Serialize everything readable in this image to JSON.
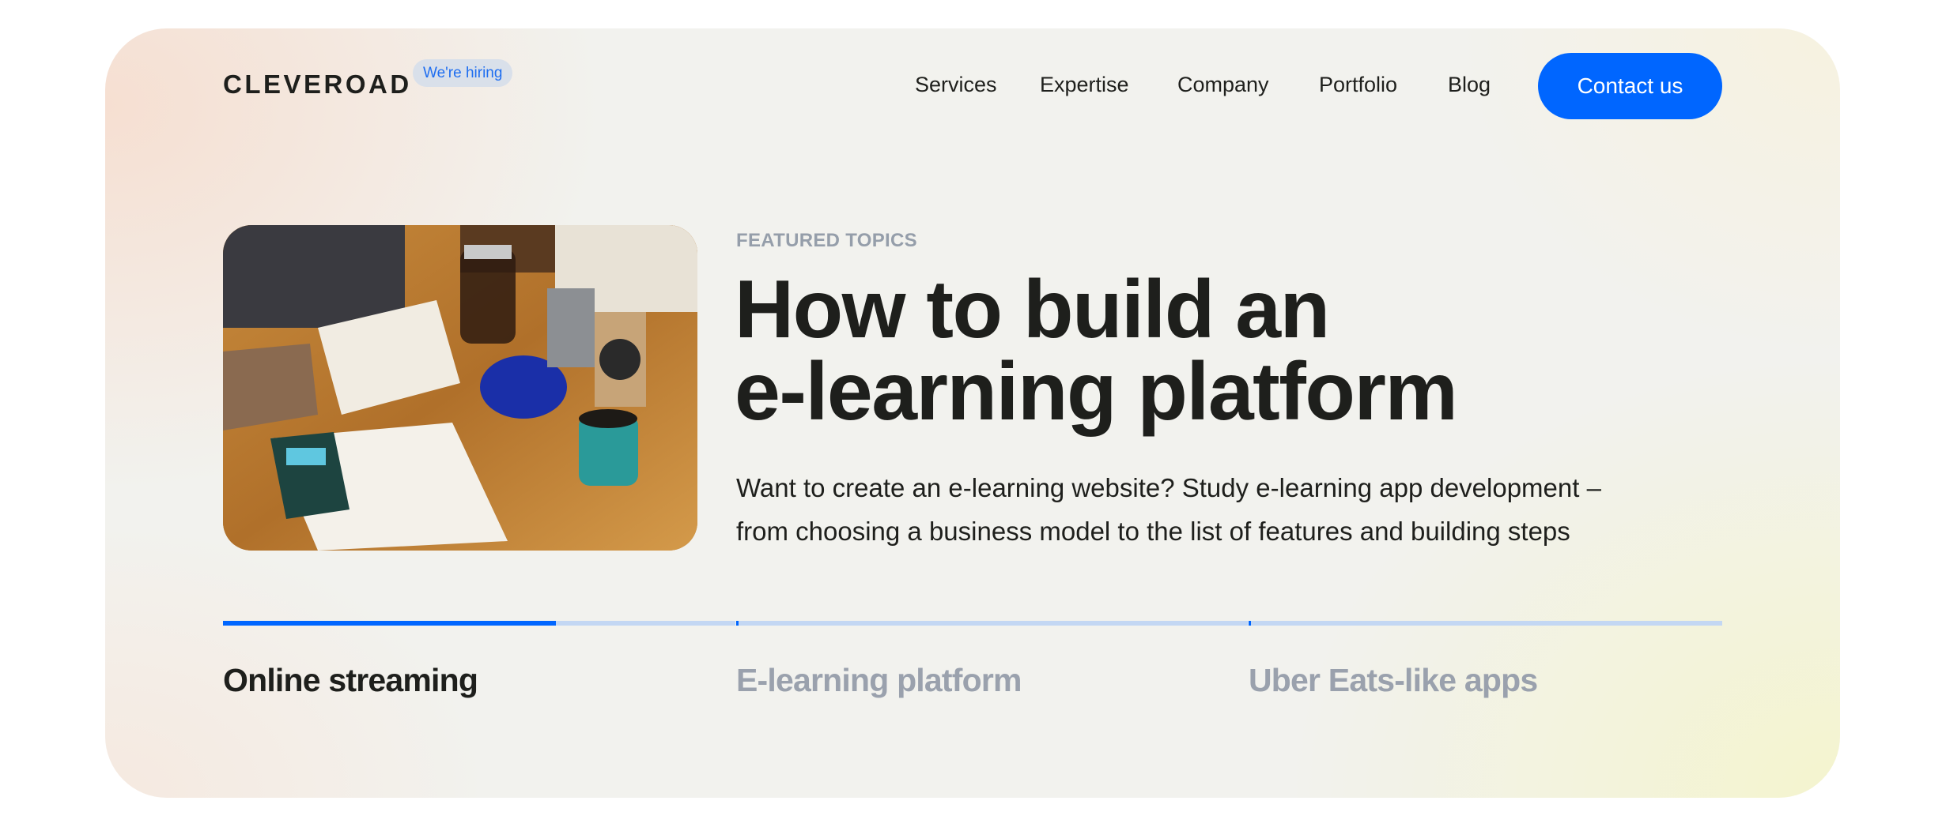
{
  "header": {
    "logo": "CLEVEROAD",
    "hiring_badge": "We're hiring",
    "nav": [
      {
        "label": "Services"
      },
      {
        "label": "Expertise"
      },
      {
        "label": "Company"
      },
      {
        "label": "Portfolio"
      },
      {
        "label": "Blog"
      }
    ],
    "contact_label": "Contact us"
  },
  "featured": {
    "eyebrow": "FEATURED TOPICS",
    "title_lines": [
      "How to build an",
      "e-learning platform"
    ],
    "subtitle_lines": [
      "Want to create an e-learning website? Study e-learning app development –",
      "from choosing a business model to the list of features and building steps"
    ],
    "image_alt": "Desk with sketchbook, coffee press, pencils and mug"
  },
  "tabs": [
    {
      "label": "Online streaming",
      "active": true,
      "progress_percent": 65
    },
    {
      "label": "E-learning platform",
      "active": false,
      "progress_percent": 0
    },
    {
      "label": "Uber Eats-like apps",
      "active": false,
      "progress_percent": 0
    }
  ],
  "colors": {
    "accent": "#0066ff",
    "text": "#1e1f1c",
    "muted": "#9aa1ad",
    "track": "#c3d7f3",
    "badge_bg": "#d9e0ea"
  }
}
